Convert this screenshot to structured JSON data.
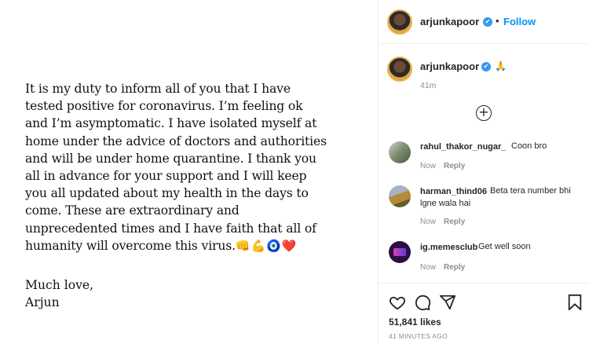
{
  "post": {
    "body": "It is my duty to inform all of you that I have\ntested positive for coronavirus. I’m feeling ok\nand I’m asymptomatic. I have isolated myself at\nhome under the advice of doctors and authorities\nand will be under home quarantine. I thank you\nall in advance for your support and I will keep\nyou all updated about my health in the days to\ncome. These are extraordinary and\nunprecedented times and I have faith that all of\nhumanity will overcome this virus.",
    "body_emoji": "👊💪🧿❤️",
    "signoff_1": "Much love,",
    "signoff_2": "Arjun"
  },
  "header": {
    "username": "arjunkapoor",
    "verified_mark": "✔",
    "separator": "•",
    "follow_label": "Follow"
  },
  "caption": {
    "username": "arjunkapoor",
    "verified_mark": "✔",
    "emoji": "🙏",
    "time": "41m"
  },
  "load_more_icon": "plus-circle-icon",
  "load_more_symbol": "+",
  "comments": [
    {
      "username": "rahul_thakor_nugar_",
      "text": "Coon bro",
      "time": "Now",
      "reply_label": "Reply"
    },
    {
      "username": "harman_thind06",
      "text": "Beta tera number bhi",
      "text2": "lgne wala hai",
      "time": "Now",
      "reply_label": "Reply"
    },
    {
      "username": "ig.memesclub",
      "text": "Get well soon",
      "time": "Now",
      "reply_label": "Reply"
    }
  ],
  "actions": {
    "likes": "51,841 likes",
    "time_ago": "41 MINUTES AGO"
  },
  "colors": {
    "link": "#0095f6",
    "verified": "#3897f0",
    "muted": "#8e8e8e"
  }
}
